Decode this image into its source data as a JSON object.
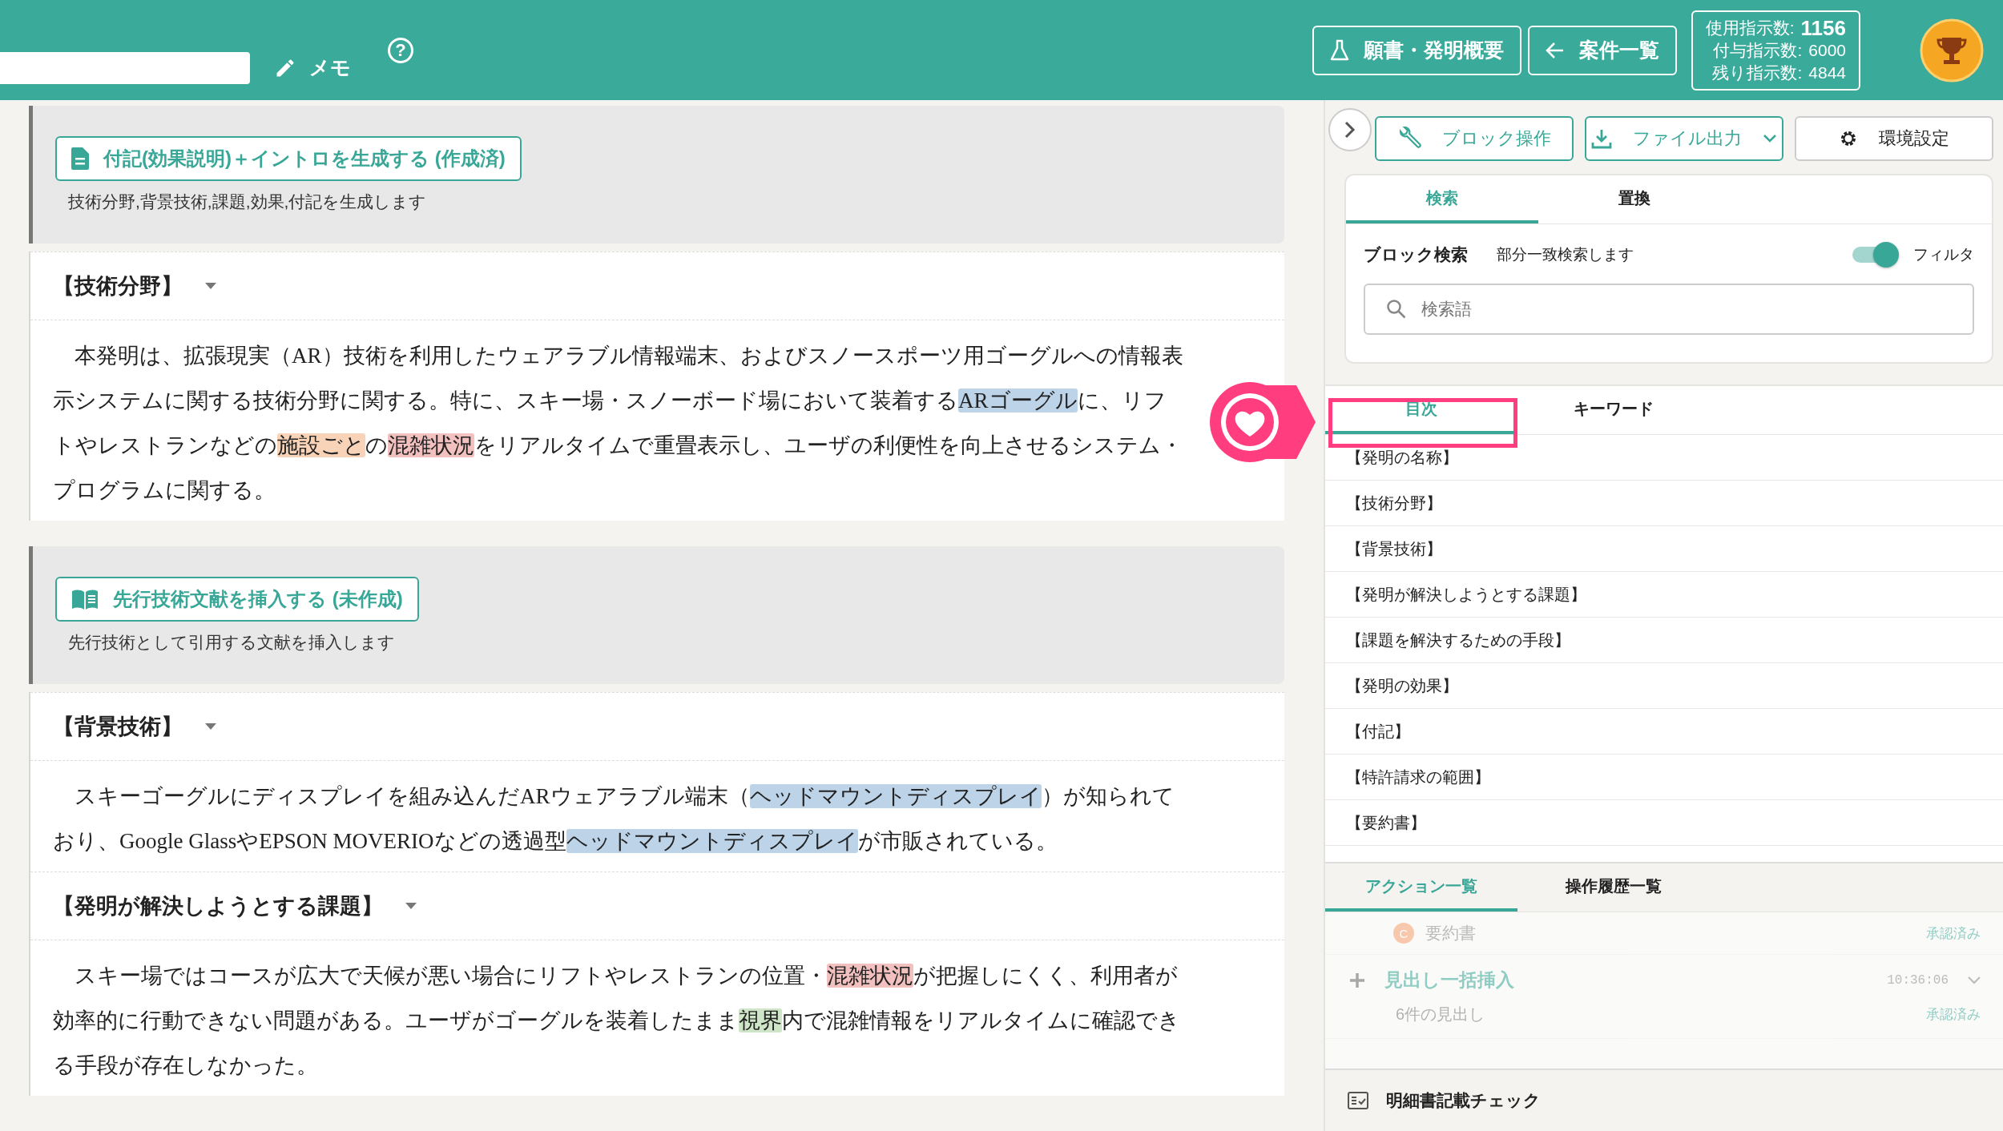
{
  "header": {
    "memo_label": "メモ",
    "help_icon": "?",
    "buttons": [
      {
        "label": "願書・発明概要"
      },
      {
        "label": "案件一覧"
      }
    ],
    "usage": [
      {
        "label": "使用指示数:",
        "value": "1156"
      },
      {
        "label": "付与指示数:",
        "value": "6000"
      },
      {
        "label": "残り指示数:",
        "value": "4844"
      }
    ]
  },
  "blocks": [
    {
      "kind": "generator",
      "button": "付記(効果説明)＋イントロを生成する (作成済)",
      "caption": "技術分野,背景技術,課題,効果,付記を生成します"
    },
    {
      "kind": "text_card",
      "sections": [
        {
          "heading": "【技術分野】",
          "paragraph": [
            {
              "text": "本発明は、拡張現実（AR）技術を利用したウェアラブル情報端末、およびスノースポーツ用ゴーグルへの情報表示システムに関する技術分野に関する。特に、スキー場・スノーボード場において装着する"
            },
            {
              "text": "ARゴーグル",
              "color": "#bcd3e8"
            },
            {
              "text": "に、リフトやレストランなどの"
            },
            {
              "text": "施設ごと",
              "color": "#f9d3b8"
            },
            {
              "text": "の"
            },
            {
              "text": "混雑状況",
              "color": "#f3c0c0"
            },
            {
              "text": "をリアルタイムで重畳表示し、ユーザの利便性を向上させるシステム・プログラムに関する。"
            }
          ]
        }
      ]
    },
    {
      "kind": "generator",
      "button": "先行技術文献を挿入する (未作成)",
      "caption": "先行技術として引用する文献を挿入します"
    },
    {
      "kind": "text_card",
      "sections": [
        {
          "heading": "【背景技術】",
          "paragraph": [
            {
              "text": "スキーゴーグルにディスプレイを組み込んだARウェアラブル端末（"
            },
            {
              "text": "ヘッドマウントディスプレイ",
              "color": "#bcd3e8"
            },
            {
              "text": "）が知られており、Google GlassやEPSON MOVERIOなどの透過型"
            },
            {
              "text": "ヘッドマウントディスプレイ",
              "color": "#bcd3e8"
            },
            {
              "text": "が市販されている。"
            }
          ]
        },
        {
          "heading": "【発明が解決しようとする課題】",
          "paragraph": [
            {
              "text": "スキー場ではコースが広大で天候が悪い場合にリフトやレストランの位置・"
            },
            {
              "text": "混雑状況",
              "color": "#f3c0c0"
            },
            {
              "text": "が把握しにくく、利用者が効率的に行動できない問題がある。ユーザがゴーグルを装着したまま"
            },
            {
              "text": "視界",
              "color": "#cfe5c8"
            },
            {
              "text": "内で混雑情報をリアルタイムに確認できる手段が存在しなかった。"
            }
          ]
        }
      ]
    }
  ],
  "side": {
    "toolbar": [
      {
        "label": "ブロック操作"
      },
      {
        "label": "ファイル出力"
      },
      {
        "label": "環境設定"
      }
    ],
    "search": {
      "tabs": [
        {
          "label": "検索",
          "selected": true
        },
        {
          "label": "置換",
          "selected": false
        }
      ],
      "title": "ブロック検索",
      "hint": "部分一致検索します",
      "filter": {
        "label": "フィルタ",
        "on": true
      },
      "placeholder": "検索語"
    },
    "toc": {
      "tabs": [
        {
          "label": "目次",
          "selected": true
        },
        {
          "label": "キーワード",
          "selected": false
        }
      ],
      "items": [
        "【発明の名称】",
        "【技術分野】",
        "【背景技術】",
        "【発明が解決しようとする課題】",
        "【課題を解決するための手段】",
        "【発明の効果】",
        "【付記】",
        "【特許請求の範囲】",
        "【要約書】"
      ]
    },
    "actions": {
      "tabs": [
        {
          "label": "アクション一覧",
          "selected": true
        },
        {
          "label": "操作履歴一覧",
          "selected": false
        }
      ],
      "items": [
        {
          "kind": "document",
          "badge": "C",
          "title": "要約書",
          "status": "承認済み"
        },
        {
          "kind": "insert",
          "title": "見出し一括挿入",
          "time": "10:36:06",
          "detail": "6件の見出し",
          "status": "承認済み"
        }
      ]
    },
    "footer": {
      "label": "明細書記載チェック"
    }
  }
}
